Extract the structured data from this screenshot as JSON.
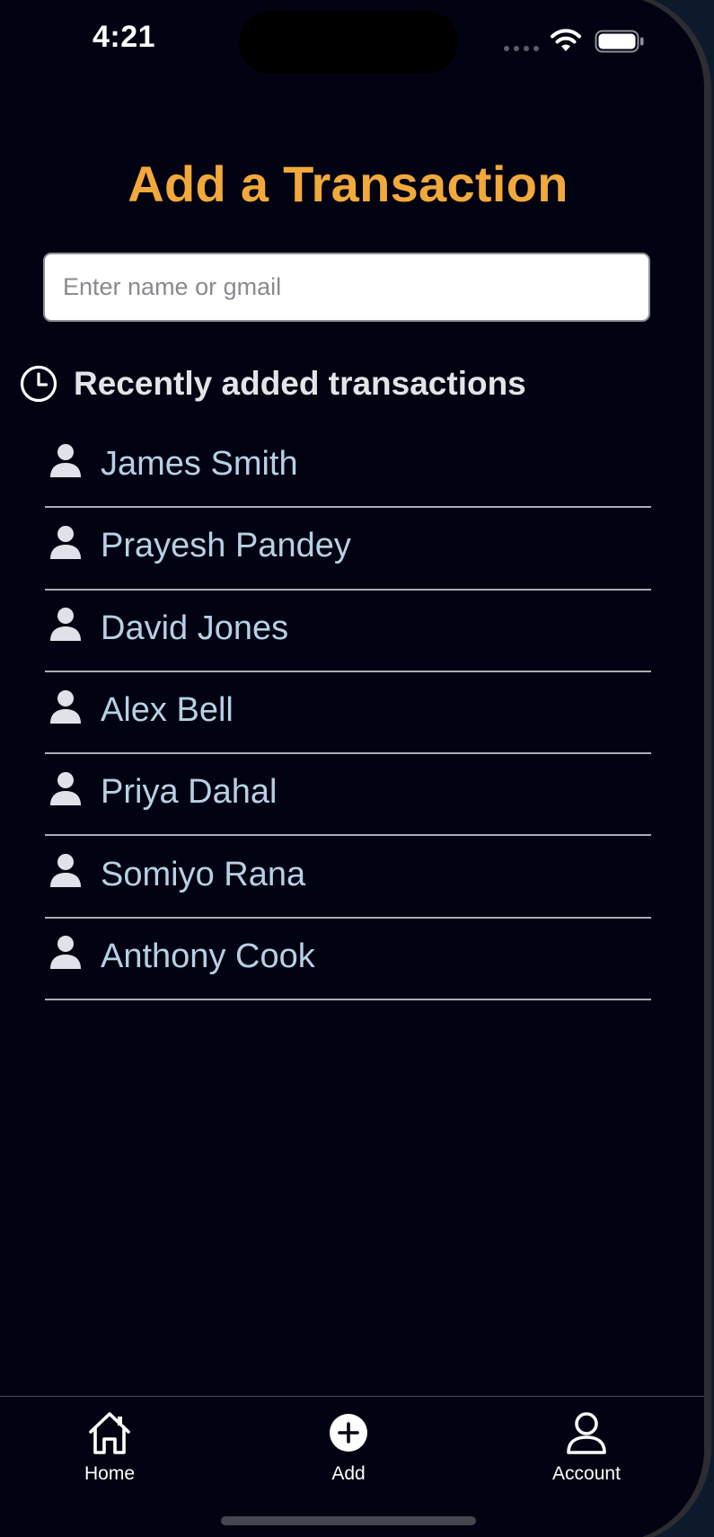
{
  "status_bar": {
    "time": "4:21"
  },
  "page": {
    "title": "Add a Transaction"
  },
  "search": {
    "placeholder": "Enter name or gmail",
    "value": ""
  },
  "recent": {
    "header": "Recently added transactions",
    "icon": "clock-icon",
    "items": [
      {
        "name": "James Smith",
        "icon": "person-icon"
      },
      {
        "name": "Prayesh Pandey",
        "icon": "person-icon"
      },
      {
        "name": "David Jones",
        "icon": "person-icon"
      },
      {
        "name": "Alex Bell",
        "icon": "person-icon"
      },
      {
        "name": "Priya Dahal",
        "icon": "person-icon"
      },
      {
        "name": "Somiyo Rana",
        "icon": "person-icon"
      },
      {
        "name": "Anthony Cook",
        "icon": "person-icon"
      }
    ]
  },
  "tabbar": {
    "tabs": [
      {
        "label": "Home",
        "icon": "home-icon"
      },
      {
        "label": "Add",
        "icon": "plus-circle-icon"
      },
      {
        "label": "Account",
        "icon": "user-outline-icon"
      }
    ]
  },
  "colors": {
    "background": "#020312",
    "title": "#f2a93b",
    "list_text": "#b7d0e3",
    "header_text": "#e3e4e8",
    "divider": "#a9adb4"
  }
}
